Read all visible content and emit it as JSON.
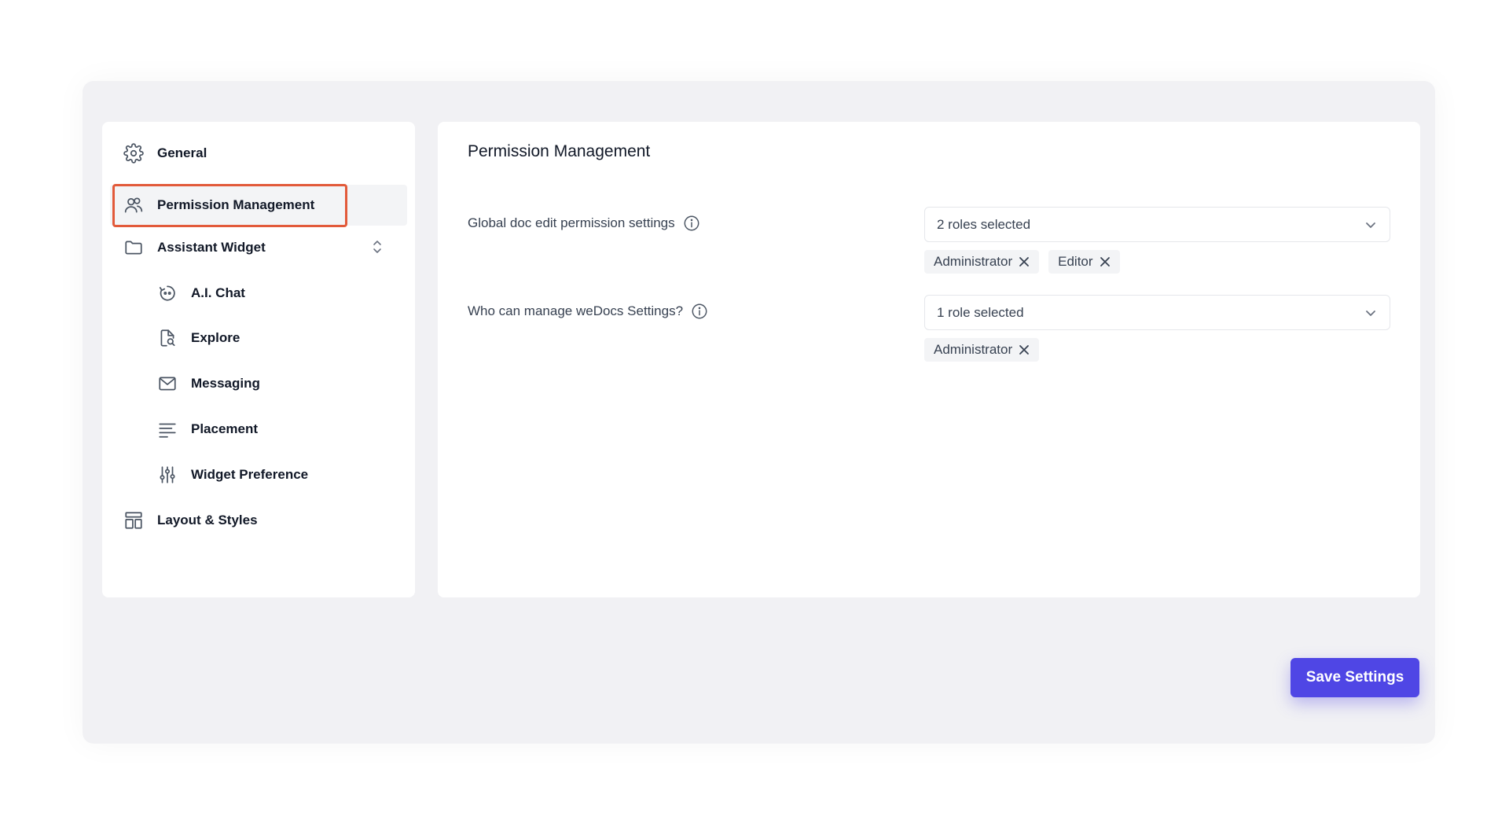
{
  "sidebar": {
    "items": [
      {
        "label": "General",
        "icon": "gear-icon"
      },
      {
        "label": "Permission Management",
        "icon": "users-icon",
        "active": true
      },
      {
        "label": "Assistant Widget",
        "icon": "folder-icon",
        "expanded": true
      },
      {
        "label": "A.I. Chat",
        "icon": "bot-icon"
      },
      {
        "label": "Explore",
        "icon": "file-search-icon"
      },
      {
        "label": "Messaging",
        "icon": "mail-icon"
      },
      {
        "label": "Placement",
        "icon": "lines-icon"
      },
      {
        "label": "Widget Preference",
        "icon": "sliders-icon"
      },
      {
        "label": "Layout & Styles",
        "icon": "layout-icon"
      }
    ]
  },
  "main": {
    "title": "Permission Management",
    "settings": [
      {
        "label": "Global doc edit permission settings",
        "select_value": "2 roles selected",
        "chips": [
          "Administrator",
          "Editor"
        ]
      },
      {
        "label": "Who can manage weDocs Settings?",
        "select_value": "1 role selected",
        "chips": [
          "Administrator"
        ]
      }
    ]
  },
  "footer": {
    "save_label": "Save Settings"
  },
  "colors": {
    "accent": "#4f46e5",
    "active_outline": "#e25a3a",
    "shell_bg": "#f1f1f4"
  }
}
